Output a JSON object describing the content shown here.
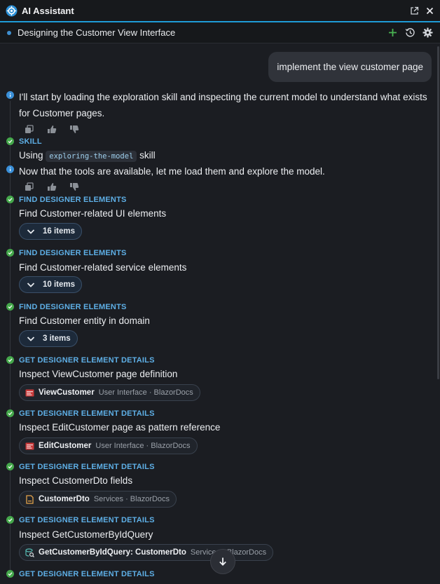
{
  "app": {
    "title": "AI Assistant"
  },
  "conversation": {
    "title": "Designing the Customer View Interface"
  },
  "user_message": "implement the view customer page",
  "assistant_messages": [
    {
      "text": "I'll start by loading the exploration skill and inspecting the current model to understand what exists for Customer pages."
    },
    {
      "text": "Now that the tools are available, let me load them and explore the model."
    }
  ],
  "skill_step": {
    "kind": "SKILL",
    "prefix": "Using",
    "code": "exploring-the-model",
    "suffix": "skill"
  },
  "find_steps": [
    {
      "kind": "FIND DESIGNER ELEMENTS",
      "text": "Find Customer-related UI elements",
      "count": "16 items"
    },
    {
      "kind": "FIND DESIGNER ELEMENTS",
      "text": "Find Customer-related service elements",
      "count": "10 items"
    },
    {
      "kind": "FIND DESIGNER ELEMENTS",
      "text": "Find Customer entity in domain",
      "count": "3 items"
    }
  ],
  "detail_steps": [
    {
      "kind": "GET DESIGNER ELEMENT DETAILS",
      "text": "Inspect ViewCustomer page definition",
      "element": "ViewCustomer",
      "meta": "User Interface · BlazorDocs",
      "icon": "page-icon"
    },
    {
      "kind": "GET DESIGNER ELEMENT DETAILS",
      "text": "Inspect EditCustomer page as pattern reference",
      "element": "EditCustomer",
      "meta": "User Interface · BlazorDocs",
      "icon": "page-icon"
    },
    {
      "kind": "GET DESIGNER ELEMENT DETAILS",
      "text": "Inspect CustomerDto fields",
      "element": "CustomerDto",
      "meta": "Services · BlazorDocs",
      "icon": "dto-icon"
    },
    {
      "kind": "GET DESIGNER ELEMENT DETAILS",
      "text": "Inspect GetCustomerByIdQuery",
      "element": "GetCustomerByIdQuery: CustomerDto",
      "meta": "Services · BlazorDocs",
      "icon": "query-icon"
    },
    {
      "kind": "GET DESIGNER ELEMENT DETAILS"
    }
  ],
  "colors": {
    "accent": "#1e9bd7",
    "success": "#45a84b",
    "info": "#3a8fd8",
    "kind_label": "#5eafe6"
  }
}
